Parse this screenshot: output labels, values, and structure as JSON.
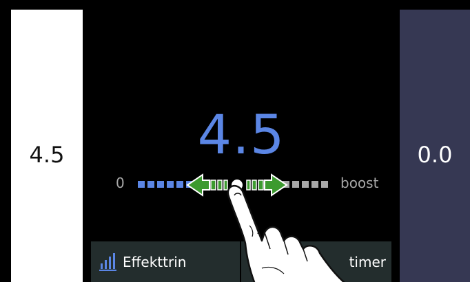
{
  "zones": {
    "left_value": "4.5",
    "right_value": "0.0"
  },
  "main": {
    "value": "4.5",
    "scale_min": "0",
    "scale_max": "boost",
    "level": 4.5
  },
  "tabs": [
    {
      "label": "Effekttrin",
      "icon": "bar-chart-icon"
    },
    {
      "label": "timer",
      "icon": ""
    }
  ],
  "icons": {
    "handle": "slide-arrows-icon",
    "gesture": "touch-hand-icon"
  },
  "colors": {
    "accent": "#5b86e5",
    "active_segment": "#5b86e5",
    "inactive_segment": "#a8a8a8",
    "arrow": "#3c9a2f",
    "right_zone": "#363853",
    "tab_bg": "#232d2d"
  }
}
